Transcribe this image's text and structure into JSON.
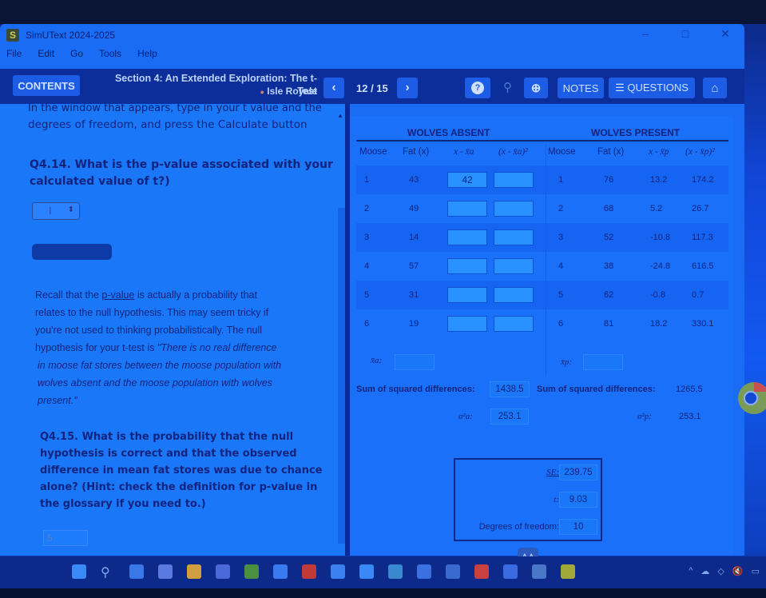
{
  "window": {
    "app_title": "SimUText 2024-2025",
    "controls": {
      "minimize": "–",
      "maximize": "□",
      "close": "✕"
    }
  },
  "menu": [
    "File",
    "Edit",
    "Go",
    "Tools",
    "Help"
  ],
  "toolbar": {
    "contents_label": "CONTENTS",
    "section_title": "Section 4: An Extended Exploration: The t-Test",
    "section_subtitle": "Isle Royale",
    "prev_icon": "‹",
    "page_indicator": "12 / 15",
    "next_icon": "›",
    "help_icon": "?",
    "zoom_out_icon": "⚲",
    "zoom_in_icon": "⊕",
    "notes_label": "NOTES",
    "questions_label": "☰ QUESTIONS",
    "home_icon": "⌂"
  },
  "left": {
    "cut_line": "In the window that appears, type in your t value and the",
    "instruction": "degrees of freedom, and press the Calculate button",
    "q414": {
      "line1": "Q4.14. What is the p-value associated with your",
      "line2": "calculated value of t?)"
    },
    "stepper_cursor": "I",
    "stepper_arrows": "⬍",
    "recall": {
      "pre_link": "Recall that the ",
      "link": "p-value",
      "post_link": " is actually a probability that",
      "line2": "relates to the null hypothesis. This may seem tricky if",
      "line3": "you're not used to thinking probabilistically. The null",
      "line4_pre": "hypothesis for your t-test is ",
      "line4_it": "\"There is no real difference",
      "line5": "in moose fat stores between the moose population with",
      "line6": "wolves absent and the moose population with wolves",
      "line7": "present.\""
    },
    "q415": {
      "line1": "Q4.15. What is the probability that the null",
      "line2": "hypothesis is correct and that the observed",
      "line3": "difference in mean fat stores was due to chance",
      "line4": "alone? (Hint: check the definition for p-value in",
      "line5": "the glossary if you need to.)"
    },
    "q415_answer": "5"
  },
  "table": {
    "absent_title": "WOLVES ABSENT",
    "present_title": "WOLVES PRESENT",
    "headers": {
      "moose": "Moose",
      "fat": "Fat (x)",
      "diff_a": "x - x̄a",
      "sq_a": "(x - x̄a)²",
      "diff_p": "x - x̄p",
      "sq_p": "(x - x̄p)²"
    },
    "rows": [
      {
        "moose_a": "1",
        "fat_a": "43",
        "diff_a": "42",
        "sq_a": "",
        "moose_p": "1",
        "fat_p": "76",
        "diff_p": "13.2",
        "sq_p": "174.2"
      },
      {
        "moose_a": "2",
        "fat_a": "49",
        "diff_a": "",
        "sq_a": "",
        "moose_p": "2",
        "fat_p": "68",
        "diff_p": "5.2",
        "sq_p": "26.7"
      },
      {
        "moose_a": "3",
        "fat_a": "14",
        "diff_a": "",
        "sq_a": "",
        "moose_p": "3",
        "fat_p": "52",
        "diff_p": "-10.8",
        "sq_p": "117.3"
      },
      {
        "moose_a": "4",
        "fat_a": "57",
        "diff_a": "",
        "sq_a": "",
        "moose_p": "4",
        "fat_p": "38",
        "diff_p": "-24.8",
        "sq_p": "616.5"
      },
      {
        "moose_a": "5",
        "fat_a": "31",
        "diff_a": "",
        "sq_a": "",
        "moose_p": "5",
        "fat_p": "62",
        "diff_p": "-0.8",
        "sq_p": "0.7"
      },
      {
        "moose_a": "6",
        "fat_a": "19",
        "diff_a": "",
        "sq_a": "",
        "moose_p": "6",
        "fat_p": "81",
        "diff_p": "18.2",
        "sq_p": "330.1"
      }
    ],
    "mean_a_label": "x̄a:",
    "mean_a_value": "",
    "mean_p_label": "x̄p:",
    "mean_p_value": "",
    "ssd_label": "Sum of squared differences:",
    "ssd_a": "1438.5",
    "ssd_p": "1265.5",
    "var_a_label": "σ²a:",
    "var_a": "253.1",
    "var_p_label": "σ²p:",
    "var_p": "253.1"
  },
  "stats": {
    "se_label": "SE:",
    "se_value": "239.75",
    "t_label": "t:",
    "t_value": "9.03",
    "df_label": "Degrees of freedom:",
    "df_value": "10",
    "calc_icon": "⋀⋀"
  },
  "taskbar": {
    "tray": [
      "^",
      "☁",
      "◇",
      "🔇",
      "▭"
    ]
  }
}
